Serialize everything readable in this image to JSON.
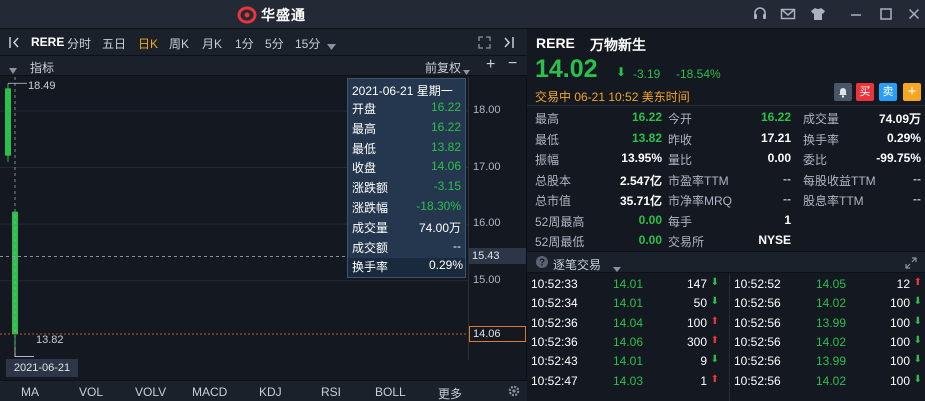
{
  "app": {
    "name": "华盛通"
  },
  "toolbar": {
    "symbol": "RERE",
    "timeframes": [
      "分时",
      "五日",
      "日K",
      "周K",
      "月K",
      "1分",
      "5分",
      "15分"
    ],
    "active_timeframe": "日K",
    "indicator_label": "指标",
    "adjust_label": "前复权"
  },
  "chart": {
    "high_label": "18.49",
    "low_label": "13.82",
    "current_marker": "14.06",
    "crosshair_price": "15.43",
    "date_label": "2021-06-21",
    "y_ticks": [
      "18.00",
      "17.00",
      "16.00",
      "15.00"
    ]
  },
  "chart_data": {
    "type": "candlestick",
    "ylim": [
      13.6,
      18.6
    ],
    "y_ticks": [
      18.0,
      17.0,
      16.0,
      15.0
    ],
    "candles": [
      {
        "date": "",
        "open": 18.4,
        "high": 18.49,
        "low": 17.1,
        "close": 17.21
      },
      {
        "date": "2021-06-21",
        "open": 16.22,
        "high": 16.22,
        "low": 13.82,
        "close": 14.06
      }
    ]
  },
  "tooltip": {
    "date": "2021-06-21 星期一",
    "rows": [
      {
        "label": "开盘",
        "value": "16.22",
        "color": "#2bc04b"
      },
      {
        "label": "最高",
        "value": "16.22",
        "color": "#2bc04b"
      },
      {
        "label": "最低",
        "value": "13.82",
        "color": "#2bc04b"
      },
      {
        "label": "收盘",
        "value": "14.06",
        "color": "#2bc04b"
      },
      {
        "label": "涨跌额",
        "value": "-3.15",
        "color": "#2bc04b"
      },
      {
        "label": "涨跌幅",
        "value": "-18.30%",
        "color": "#2bc04b"
      },
      {
        "label": "成交量",
        "value": "74.00万",
        "color": "#ffffff"
      },
      {
        "label": "成交额",
        "value": "--",
        "color": "#ffffff"
      },
      {
        "label": "换手率",
        "value": "0.29%",
        "color": "#ffffff"
      }
    ]
  },
  "indicator_tabs": [
    "MA",
    "VOL",
    "VOLV",
    "MACD",
    "KDJ",
    "RSI",
    "BOLL",
    "更多"
  ],
  "quote": {
    "symbol": "RERE",
    "name": "万物新生",
    "price": "14.02",
    "change": "-3.19",
    "change_pct": "-18.54%",
    "status": "交易中 06-21 10:52 美东时间",
    "buttons": {
      "buy": "买",
      "sell": "卖"
    }
  },
  "stats": [
    [
      {
        "label": "最高",
        "value": "16.22",
        "color": "#2bc04b"
      },
      {
        "label": "今开",
        "value": "16.22",
        "color": "#2bc04b"
      },
      {
        "label": "成交量",
        "value": "74.09万",
        "color": "#ffffff"
      }
    ],
    [
      {
        "label": "最低",
        "value": "13.82",
        "color": "#2bc04b"
      },
      {
        "label": "昨收",
        "value": "17.21",
        "color": "#ffffff"
      },
      {
        "label": "换手率",
        "value": "0.29%",
        "color": "#ffffff"
      }
    ],
    [
      {
        "label": "振幅",
        "value": "13.95%",
        "color": "#ffffff"
      },
      {
        "label": "量比",
        "value": "0.00",
        "color": "#ffffff"
      },
      {
        "label": "委比",
        "value": "-99.75%",
        "color": "#ffffff"
      }
    ],
    [
      {
        "label": "总股本",
        "value": "2.547亿",
        "color": "#ffffff"
      },
      {
        "label": "市盈率TTM",
        "value": "--",
        "color": "#aeb5c2"
      },
      {
        "label": "每股收益TTM",
        "value": "--",
        "color": "#aeb5c2"
      }
    ],
    [
      {
        "label": "总市值",
        "value": "35.71亿",
        "color": "#ffffff"
      },
      {
        "label": "市净率MRQ",
        "value": "--",
        "color": "#aeb5c2"
      },
      {
        "label": "股息率TTM",
        "value": "--",
        "color": "#aeb5c2"
      }
    ],
    [
      {
        "label": "52周最高",
        "value": "0.00",
        "color": "#2bc04b"
      },
      {
        "label": "每手",
        "value": "1",
        "color": "#ffffff"
      }
    ],
    [
      {
        "label": "52周最低",
        "value": "0.00",
        "color": "#2bc04b"
      },
      {
        "label": "交易所",
        "value": "NYSE",
        "color": "#ffffff"
      }
    ]
  ],
  "trades_header": "逐笔交易",
  "trades_left": [
    {
      "time": "10:52:33",
      "price": "14.01",
      "qty": "147",
      "dir": "down"
    },
    {
      "time": "10:52:34",
      "price": "14.01",
      "qty": "50",
      "dir": "down"
    },
    {
      "time": "10:52:36",
      "price": "14.04",
      "qty": "100",
      "dir": "up"
    },
    {
      "time": "10:52:36",
      "price": "14.06",
      "qty": "300",
      "dir": "up"
    },
    {
      "time": "10:52:43",
      "price": "14.01",
      "qty": "9",
      "dir": "down"
    },
    {
      "time": "10:52:47",
      "price": "14.03",
      "qty": "1",
      "dir": "up"
    }
  ],
  "trades_right": [
    {
      "time": "10:52:52",
      "price": "14.05",
      "qty": "12",
      "dir": "up"
    },
    {
      "time": "10:52:56",
      "price": "14.02",
      "qty": "100",
      "dir": "down"
    },
    {
      "time": "10:52:56",
      "price": "13.99",
      "qty": "100",
      "dir": "down"
    },
    {
      "time": "10:52:56",
      "price": "14.02",
      "qty": "100",
      "dir": "down"
    },
    {
      "time": "10:52:56",
      "price": "13.99",
      "qty": "100",
      "dir": "down"
    },
    {
      "time": "10:52:56",
      "price": "14.02",
      "qty": "100",
      "dir": "down"
    }
  ]
}
